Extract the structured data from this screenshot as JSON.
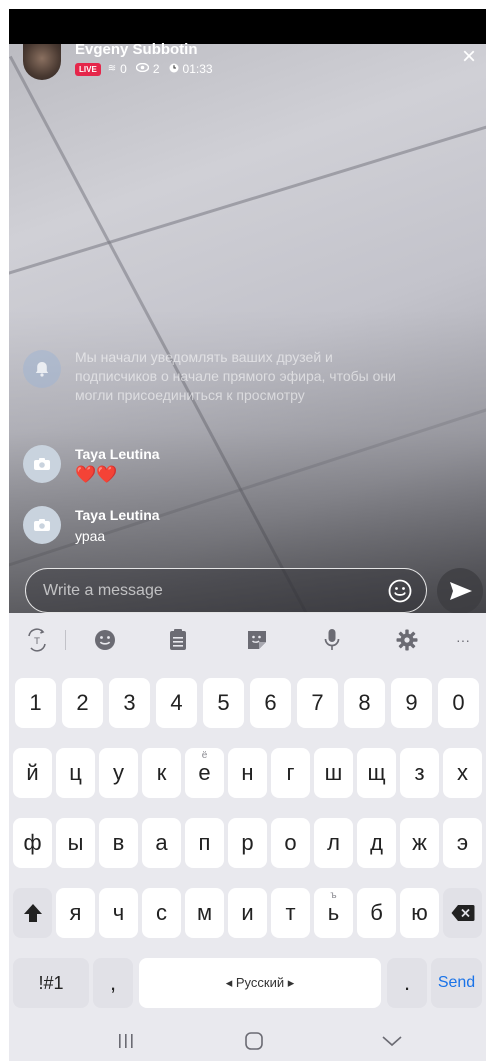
{
  "live": {
    "streamer_name": "Evgeny Subbotin",
    "badge": "LIVE",
    "coins": "0",
    "viewers": "2",
    "duration": "01:33",
    "close_icon": "×"
  },
  "chat": {
    "notice": "Мы начали уведомлять ваших друзей и подписчиков о начале прямого эфира, чтобы они могли присоединиться к просмотру",
    "comments": [
      {
        "author": "Taya Leutina",
        "text": "❤️❤️"
      },
      {
        "author": "Taya Leutina",
        "text": "ураа"
      }
    ]
  },
  "composer": {
    "placeholder": "Write a message"
  },
  "keyboard": {
    "toolbar_more": "···",
    "numbers": [
      "1",
      "2",
      "3",
      "4",
      "5",
      "6",
      "7",
      "8",
      "9",
      "0"
    ],
    "row1": [
      "й",
      "ц",
      "у",
      "к",
      "е",
      "н",
      "г",
      "ш",
      "щ",
      "з",
      "х"
    ],
    "row1_e_alt": "ё",
    "row2": [
      "ф",
      "ы",
      "в",
      "а",
      "п",
      "р",
      "о",
      "л",
      "д",
      "ж",
      "э"
    ],
    "row3": [
      "я",
      "ч",
      "с",
      "м",
      "и",
      "т",
      "ь",
      "б",
      "ю"
    ],
    "row3_soft_alt": "ъ",
    "symbols_key": "!#1",
    "comma_key": ",",
    "space_label": "◂ Русский ▸",
    "period_key": ".",
    "send_key": "Send",
    "accent_color": "#1a73e8"
  }
}
